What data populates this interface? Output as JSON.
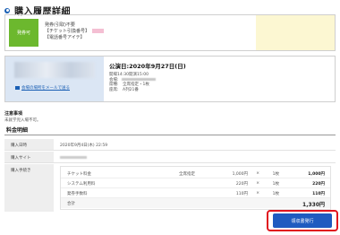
{
  "page": {
    "title": "購入履歴詳細"
  },
  "notice": {
    "badge": "発券可",
    "line1": "発券(引取)不要",
    "line2": "【チケット引換番号】",
    "line3": "【電話番号アイテ】"
  },
  "event": {
    "mail_link": "会場の場所をメールで送る",
    "date": "公演日:2020年9月27日(日)",
    "lines": [
      "開場14:30開演15:00",
      "会場:",
      "席種:　全席指定・1枚",
      "座席:　A列21番"
    ]
  },
  "notes": {
    "heading": "注意事項",
    "text": "未就学児入場不可。"
  },
  "fees": {
    "heading": "料金明細",
    "rows": [
      {
        "label": "購入日時",
        "value": "2020年9月4日(木) 22:59"
      },
      {
        "label": "購入サイト",
        "value": ""
      },
      {
        "label": "購入手続き",
        "value": ""
      }
    ],
    "items": [
      {
        "name": "チケット料金",
        "kind": "全席指定",
        "price": "1,000円",
        "x": "×",
        "qty": "1枚",
        "amount": "1,000円"
      },
      {
        "name": "システム利用料",
        "kind": "",
        "price": "220円",
        "x": "×",
        "qty": "1枚",
        "amount": "220円"
      },
      {
        "name": "発券手数料",
        "kind": "",
        "price": "110円",
        "x": "×",
        "qty": "1枚",
        "amount": "110円"
      }
    ],
    "total_label": "合計",
    "total": "1,330円"
  },
  "actions": {
    "reissue": "領収書発行"
  },
  "colors": {
    "accent": "#1f5bc0",
    "badge": "#6cb82e",
    "highlight_frame": "#e0141e"
  }
}
